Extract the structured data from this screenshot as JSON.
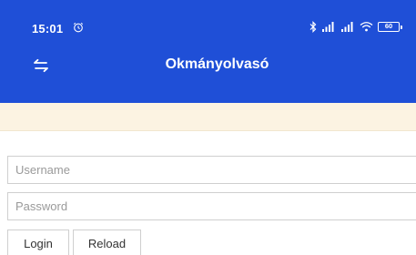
{
  "status_bar": {
    "time": "15:01",
    "battery": "60",
    "icons": [
      "alarm-icon",
      "bluetooth-icon",
      "signal-icon",
      "signal-icon",
      "wifi-icon",
      "battery-icon"
    ]
  },
  "app_bar": {
    "title": "Okmányolvasó",
    "nav_icon": "swap-arrows-icon",
    "background_color": "#1f4fd7"
  },
  "notice": {
    "background_color": "#fcf3e2"
  },
  "login_form": {
    "username_placeholder": "Username",
    "password_placeholder": "Password",
    "login_label": "Login",
    "reload_label": "Reload"
  }
}
